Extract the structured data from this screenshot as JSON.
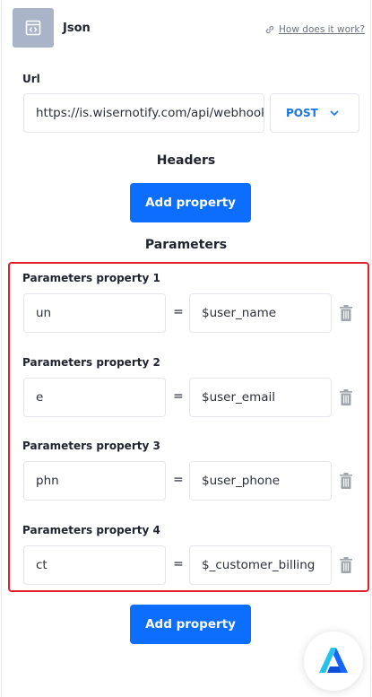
{
  "header": {
    "title": "Json",
    "help_link": "How does it work?"
  },
  "url": {
    "label": "Url",
    "value": "https://is.wisernotify.com/api/webhook"
  },
  "method": {
    "selected": "POST"
  },
  "headers": {
    "title": "Headers",
    "add_label": "Add property"
  },
  "parameters": {
    "title": "Parameters",
    "add_label": "Add property",
    "items": [
      {
        "label": "Parameters property 1",
        "key": "un",
        "value": "$user_name"
      },
      {
        "label": "Parameters property 2",
        "key": "e",
        "value": "$user_email"
      },
      {
        "label": "Parameters property 3",
        "key": "phn",
        "value": "$user_phone"
      },
      {
        "label": "Parameters property 4",
        "key": "ct",
        "value": "$_customer_billing"
      }
    ]
  },
  "colors": {
    "accent": "#0d6efd",
    "highlight": "#e0202a",
    "icon_bg": "#a9b4c9"
  }
}
